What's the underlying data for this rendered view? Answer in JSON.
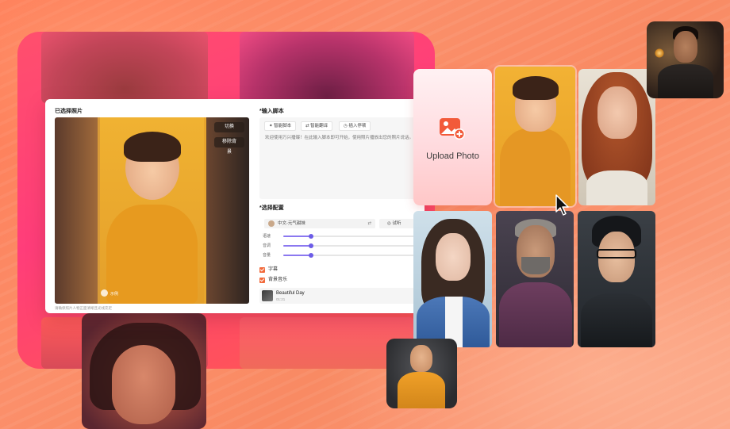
{
  "app": {
    "photo_section_title": "已选择照片",
    "script_section_title": "*输入脚本",
    "voice_section_title": "*选择配置",
    "crop_button": "切换",
    "replace_button": "移除背景",
    "caption": "请确保照片人物正面清晰且光线充足",
    "watermark_label": "示例",
    "script_chips": [
      "智能脚本",
      "智能翻译",
      "插入停顿"
    ],
    "script_placeholder": "欢迎使用万兴播爆！在此输入脚本即可开始，使用照片播放出您的照片说话。",
    "voice_select": "中文-元气甜妹",
    "voice_try": "试听",
    "sliders": [
      {
        "label": "语速",
        "value": 0.2
      },
      {
        "label": "音调",
        "value": 0.2
      },
      {
        "label": "音量",
        "value": 0.2
      }
    ],
    "subtitle_check": "字幕",
    "music_check": "背景音乐",
    "music_name": "Beautiful Day",
    "music_time": "01:21"
  },
  "gallery": {
    "upload_label": "Upload Photo"
  },
  "colors": {
    "accent": "#f26a3b",
    "slider": "#6c5ce7",
    "backdrop": "#ff3d7a"
  }
}
